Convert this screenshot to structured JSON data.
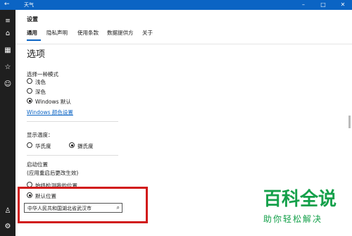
{
  "app": {
    "title": "天气"
  },
  "window_controls": {
    "minimize": "–",
    "maximize": "□",
    "close": "✕"
  },
  "sidebar": [
    {
      "icon": "hamburger-icon",
      "glyph": "≡"
    },
    {
      "icon": "home-icon",
      "glyph": "⌂"
    },
    {
      "icon": "map-icon",
      "glyph": "▦"
    },
    {
      "icon": "star-list-icon",
      "glyph": "☆"
    },
    {
      "icon": "smiley-icon",
      "glyph": "☺"
    },
    {
      "icon": "account-icon",
      "glyph": "♙"
    },
    {
      "icon": "settings-icon",
      "glyph": "⚙"
    }
  ],
  "header": {
    "title": "设置"
  },
  "tabs": [
    {
      "label": "通用",
      "active": true
    },
    {
      "label": "隐私声明",
      "active": false
    },
    {
      "label": "使用条款",
      "active": false
    },
    {
      "label": "数据提供方",
      "active": false
    },
    {
      "label": "关于",
      "active": false
    }
  ],
  "options": {
    "heading": "选项",
    "mode": {
      "label": "选择一种模式",
      "choices": [
        {
          "label": "浅色",
          "selected": false
        },
        {
          "label": "深色",
          "selected": false
        },
        {
          "label": "Windows 默认",
          "selected": true
        }
      ],
      "link": "Windows 颜色设置"
    },
    "temperature": {
      "label": "显示温度：",
      "choices": [
        {
          "label": "华氏度",
          "selected": false
        },
        {
          "label": "摄氏度",
          "selected": true
        }
      ]
    },
    "launch": {
      "label": "启动位置",
      "note": "(应用重启后更改生效)",
      "choices": [
        {
          "label": "始终检测我的位置",
          "selected": false
        },
        {
          "label": "默认位置",
          "selected": true
        }
      ],
      "search_value": "中华人民共和国湖北省武汉市"
    }
  },
  "watermark": {
    "big": "百科全说",
    "small": "助你轻松解决"
  },
  "colors": {
    "accent": "#0b64c4",
    "highlight_box": "#d11a1a",
    "watermark": "#14a04a"
  }
}
